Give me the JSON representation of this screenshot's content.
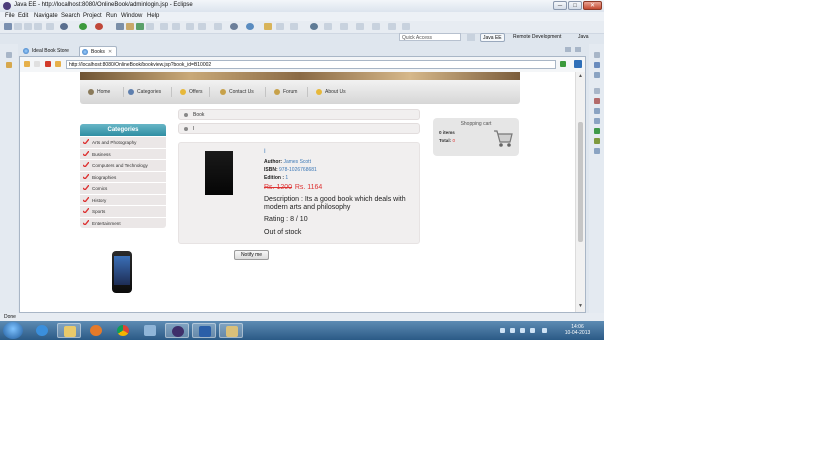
{
  "window": {
    "title": "Java EE - http://localhost:8080/OnlineBook/adminlogin.jsp - Eclipse",
    "minimize": "─",
    "maximize": "□",
    "close": "✕"
  },
  "menubar": [
    "File",
    "Edit",
    "Navigate",
    "Search",
    "Project",
    "Run",
    "Window",
    "Help"
  ],
  "perspectives": {
    "quick_access_placeholder": "Quick Access",
    "items": [
      "Java EE",
      "Remote Development",
      "Java"
    ]
  },
  "editor_tabs": [
    {
      "label": "Ideal Book Store",
      "active": false
    },
    {
      "label": "Books",
      "active": true,
      "close": "✕"
    }
  ],
  "browser": {
    "url": "http://localhost:8080/OnlineBook/bookview.jsp?book_id=B10002"
  },
  "site": {
    "menu": [
      "Home",
      "Categories",
      "Offers",
      "Contact Us",
      "Forum",
      "About Us"
    ],
    "breadcrumb_1": "Book",
    "breadcrumb_2": "I",
    "categories": {
      "title": "Categories",
      "items": [
        "Arts and Photography",
        "Business",
        "Computers and Technology",
        "Biographies",
        "Comics",
        "History",
        "Sports",
        "Entertainment"
      ]
    },
    "book": {
      "title": "I",
      "author_label": "Author:",
      "author": "James Scott",
      "isbn_label": "ISBN:",
      "isbn": "978-1026768681",
      "edition_label": "Edition :",
      "edition": "1",
      "old_price": "Rs. 1200",
      "new_price": "Rs. 1164",
      "description": "Description : Its a good book which deals with modern arts and philosophy",
      "rating": "Rating : 8 / 10",
      "stock": "Out of stock",
      "notify_button": "Notify me"
    },
    "cart": {
      "title": "Shopping cart",
      "items_text": "0 items",
      "total_label": "Total:",
      "total_value": "0"
    }
  },
  "statusbar": {
    "text": "Done"
  },
  "taskbar": {
    "time": "14:06",
    "date": "10-04-2013"
  }
}
